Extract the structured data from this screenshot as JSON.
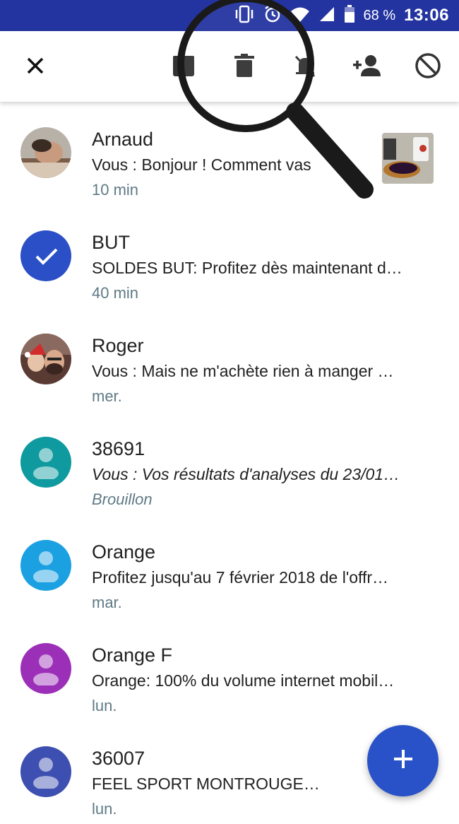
{
  "status_bar": {
    "battery_percent": "68 %",
    "clock": "13:06",
    "icons": [
      "vibrate-icon",
      "alarm-icon",
      "wifi-icon",
      "signal-icon",
      "battery-icon"
    ]
  },
  "action_bar": {
    "actions": [
      "close-icon",
      "archive-icon",
      "delete-icon",
      "mute-notifications-icon",
      "add-contact-icon",
      "block-icon"
    ]
  },
  "conversations": [
    {
      "name": "Arnaud",
      "snippet": "Vous : Bonjour ! Comment vas",
      "time": "10 min",
      "avatar": "photo",
      "has_thumbnail": true
    },
    {
      "name": "BUT",
      "snippet": "SOLDES BUT: Profitez dès maintenant d…",
      "time": "40 min",
      "avatar": "selected-check",
      "color": "#2b4fc7"
    },
    {
      "name": "Roger",
      "snippet": "Vous : Mais ne m'achète rien à manger …",
      "time": "mer.",
      "avatar": "photo"
    },
    {
      "name": "38691",
      "snippet": "Vous : Vos résultats d'analyses du 23/01…",
      "time": "Brouillon",
      "avatar": "default-person",
      "color": "#0e9a9e",
      "draft": true
    },
    {
      "name": "Orange",
      "snippet": "Profitez jusqu'au 7 février 2018 de l'offr…",
      "time": "mar.",
      "avatar": "default-person",
      "color": "#1ba1e2"
    },
    {
      "name": "Orange F",
      "snippet": "Orange: 100% du volume internet mobil…",
      "time": "lun.",
      "avatar": "default-person",
      "color": "#9c2fb8"
    },
    {
      "name": "36007",
      "snippet": "FEEL SPORT MONTROUGE…",
      "time": "lun.",
      "avatar": "default-person",
      "color": "#3d4fb0"
    }
  ],
  "fab": {
    "icon": "plus-icon"
  },
  "overlay": {
    "icon": "magnifier-icon"
  }
}
